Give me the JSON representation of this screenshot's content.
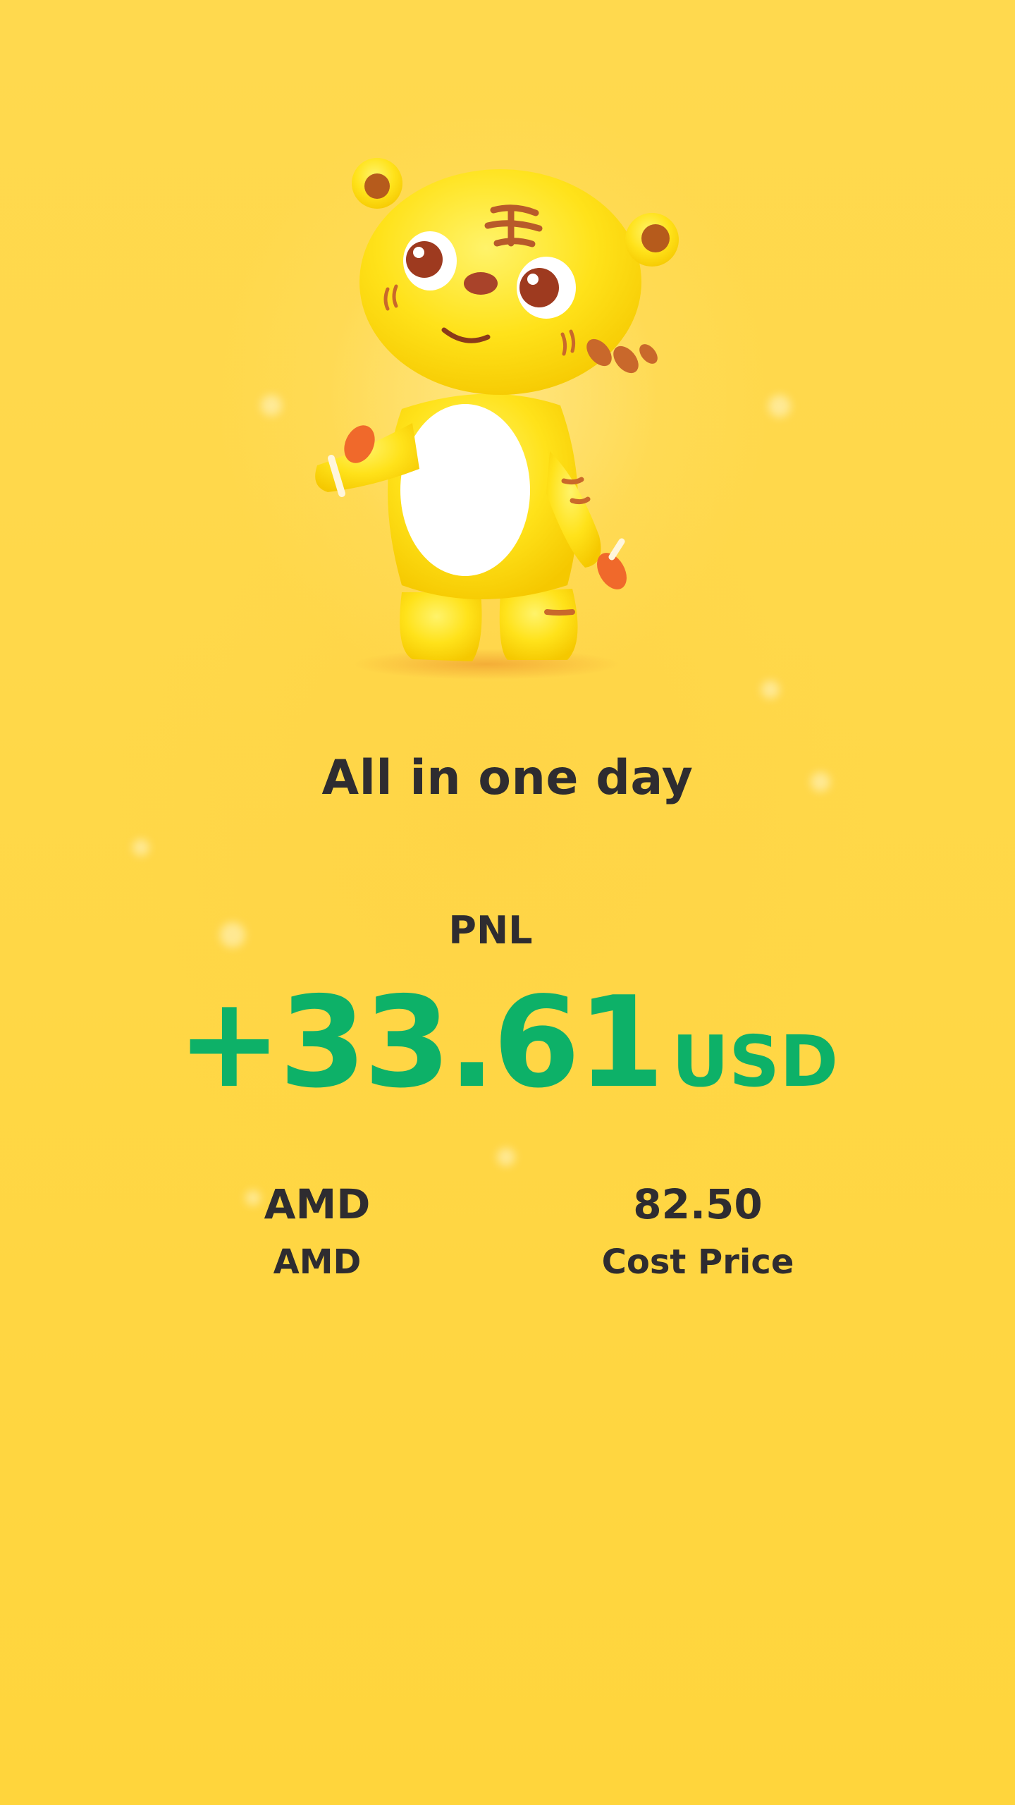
{
  "colors": {
    "background": "#ffd84a",
    "text_primary": "#2e2c30",
    "profit_green": "#0db168"
  },
  "hero": {
    "icon": "tiger-mascot-icon"
  },
  "headline": "All in one day",
  "pnl": {
    "label": "PNL",
    "amount": "+33.61",
    "currency": "USD"
  },
  "stats": {
    "symbol": {
      "value": "AMD",
      "label": "AMD"
    },
    "cost": {
      "value": "82.50",
      "label": "Cost Price"
    }
  }
}
